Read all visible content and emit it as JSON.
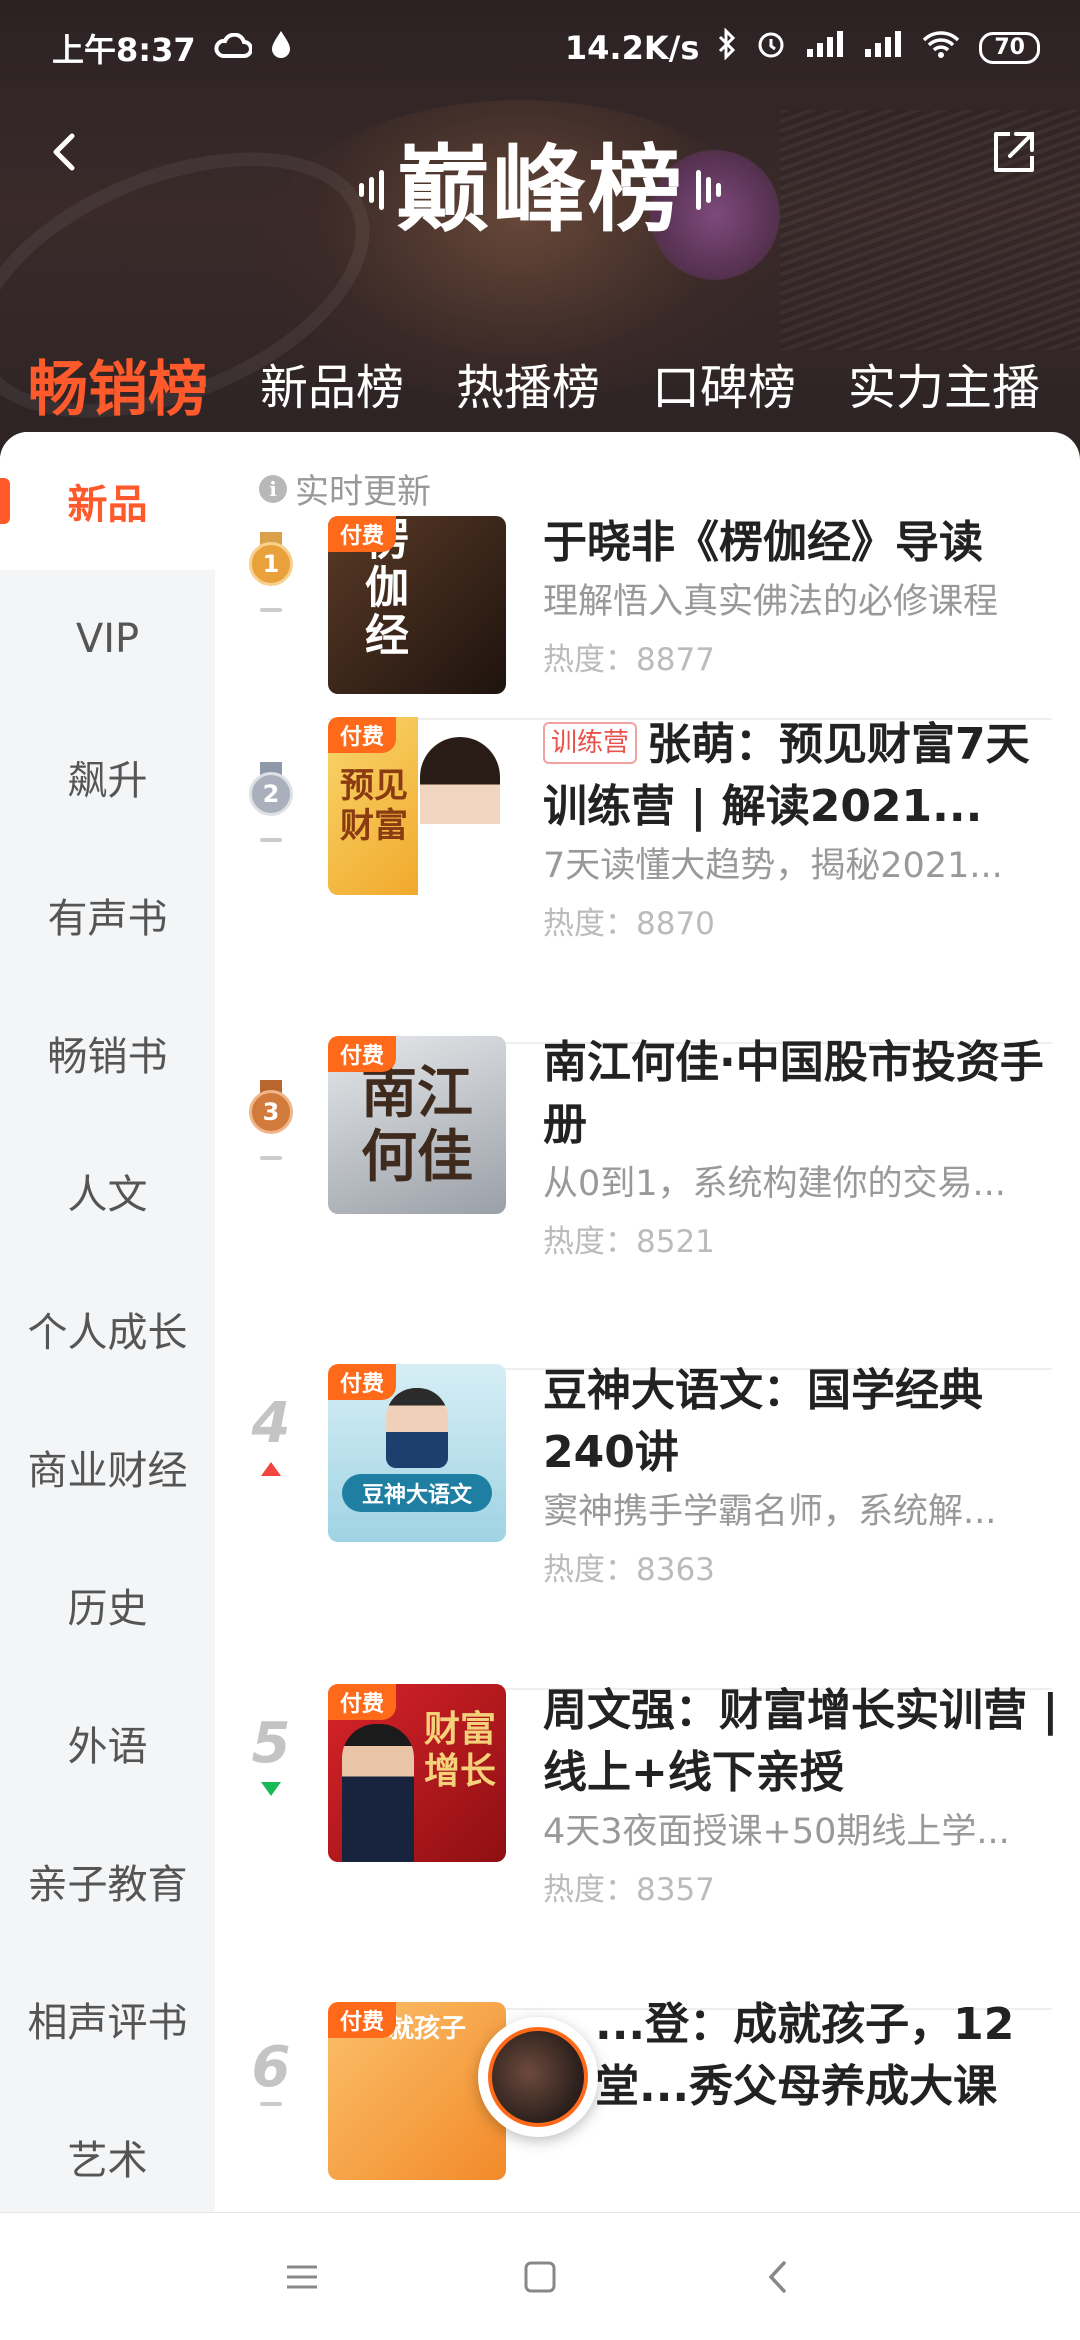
{
  "status_bar": {
    "time": "上午8:37",
    "net_speed": "14.2K/s",
    "battery": "70"
  },
  "header": {
    "title": "巅峰榜",
    "tabs": [
      "畅销榜",
      "新品榜",
      "热播榜",
      "口碑榜",
      "实力主播"
    ]
  },
  "sidebar": {
    "items": [
      "新品",
      "VIP",
      "飙升",
      "有声书",
      "畅销书",
      "人文",
      "个人成长",
      "商业财经",
      "历史",
      "外语",
      "亲子教育",
      "相声评书",
      "艺术"
    ]
  },
  "list": {
    "update_note": "实时更新",
    "tag_paid": "付费",
    "heat_label": "热度：",
    "items": [
      {
        "rank": "1",
        "title": "于晓非《楞伽经》导读",
        "desc": "理解悟入真实佛法的必修课程",
        "heat": "8877",
        "cover_text": "楞伽经",
        "cover_color": "#3a2418"
      },
      {
        "rank": "2",
        "badge": "训练营",
        "title": "张萌：预见财富7天训练营 | 解读2021...",
        "desc": "7天读懂大趋势，揭秘2021...",
        "heat": "8870",
        "cover_text": "预见财富",
        "cover_color": "#f6c453"
      },
      {
        "rank": "3",
        "title": "南江何佳·中国股市投资手册",
        "desc": "从0到1，系统构建你的交易...",
        "heat": "8521",
        "cover_text": "南江何佳",
        "cover_color": "#cfd3d8"
      },
      {
        "rank": "4",
        "title": "豆神大语文：国学经典240讲",
        "desc": "窦神携手学霸名师，系统解...",
        "heat": "8363",
        "cover_text": "豆神大语文",
        "cover_color": "#bfe4ef"
      },
      {
        "rank": "5",
        "title": "周文强：财富增长实训营 | 线上+线下亲授",
        "desc": "4天3夜面授课+50期线上学...",
        "heat": "8357",
        "cover_text": "财富增长",
        "cover_color": "#c3171d"
      },
      {
        "rank": "6",
        "title": "...登：成就孩子，12堂...秀父母养成大课",
        "cover_text": "就孩子",
        "cover_color": "#f7a84a"
      }
    ]
  },
  "colors": {
    "accent": "#ff5a2b",
    "gold": "#e9a23b",
    "silver": "#a9b0bb",
    "bronze": "#d07a3c"
  }
}
